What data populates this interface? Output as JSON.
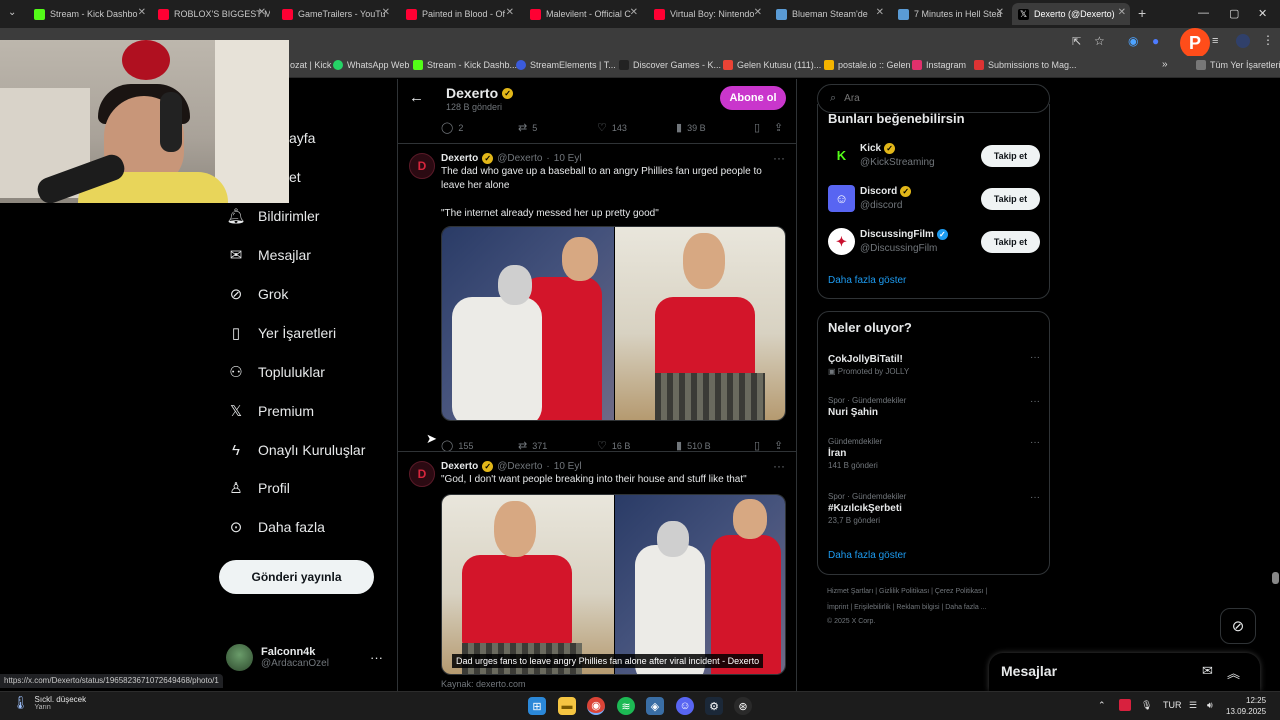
{
  "browser": {
    "tabs": [
      {
        "label": "Stream - Kick Dashbo",
        "color": "#53fc18"
      },
      {
        "label": "ROBLOX'S BIGGEST M",
        "color": "#ff0033"
      },
      {
        "label": "GameTrailers - YouTu",
        "color": "#ff0033"
      },
      {
        "label": "Painted in Blood - Of",
        "color": "#ff0033"
      },
      {
        "label": "Malevilent - Official C",
        "color": "#ff0033"
      },
      {
        "label": "Virtual Boy: Nintendo",
        "color": "#ff0033"
      },
      {
        "label": "Blueman Steam'de",
        "color": "#5a9bd5"
      },
      {
        "label": "7 Minutes in Hell Stea",
        "color": "#5a9bd5"
      },
      {
        "label": "Dexerto (@Dexerto)",
        "color": "#ffffff",
        "active": true
      }
    ],
    "new_tab": "+",
    "window_controls": [
      "—",
      "▢",
      "✕"
    ],
    "bookmarks": [
      {
        "label": "ozat | Kick",
        "color": "#53fc18"
      },
      {
        "label": "WhatsApp Web",
        "color": "#25d366"
      },
      {
        "label": "Stream - Kick Dashb...",
        "color": "#53fc18"
      },
      {
        "label": "StreamElements | T...",
        "color": "#3b5bdb"
      },
      {
        "label": "Discover Games - K...",
        "color": "#222222"
      },
      {
        "label": "Gelen Kutusu (111)...",
        "color": "#ea4335"
      },
      {
        "label": "postale.io :: Gelen",
        "color": "#f4b400"
      },
      {
        "label": "Instagram",
        "color": "#e1306c"
      },
      {
        "label": "Submissions to Mag...",
        "color": "#d33"
      }
    ],
    "all_bookmarks": "Tüm Yer İşaretleri",
    "status_url": "https://x.com/Dexerto/status/1965823671072649468/photo/1"
  },
  "nav": {
    "items": [
      {
        "label": "ayfa",
        "icon": "home-icon"
      },
      {
        "label": "et",
        "icon": "explore-icon"
      },
      {
        "label": "Bildirimler",
        "icon": "bell-icon"
      },
      {
        "label": "Mesajlar",
        "icon": "envelope-icon"
      },
      {
        "label": "Grok",
        "icon": "grok-icon"
      },
      {
        "label": "Yer İşaretleri",
        "icon": "bookmark-icon"
      },
      {
        "label": "Topluluklar",
        "icon": "communities-icon"
      },
      {
        "label": "Premium",
        "icon": "x-logo-icon"
      },
      {
        "label": "Onaylı Kuruluşlar",
        "icon": "lightning-icon"
      },
      {
        "label": "Profil",
        "icon": "person-icon"
      },
      {
        "label": "Daha fazla",
        "icon": "more-circle-icon"
      }
    ],
    "post_button": "Gönderi yayınla",
    "account": {
      "name": "Falconn4k",
      "handle": "@ArdacanOzel"
    }
  },
  "profile_header": {
    "name": "Dexerto",
    "post_count": "128 B gönderi",
    "subscribe": "Abone ol"
  },
  "top_actions": {
    "replies": "2",
    "reposts": "5",
    "likes": "143",
    "views": "39 B"
  },
  "tweets": [
    {
      "name": "Dexerto",
      "handle": "@Dexerto",
      "date": "10 Eyl",
      "text": "The dad who gave up a baseball to an angry Phillies fan urged people to leave her alone\n\n\"The internet already messed her up pretty good\"",
      "actions": {
        "replies": "155",
        "reposts": "371",
        "likes": "16 B",
        "views": "510 B"
      }
    },
    {
      "name": "Dexerto",
      "handle": "@Dexerto",
      "date": "10 Eyl",
      "text": "\"God, I don't want people breaking into their house and stuff like that\"",
      "caption": "Dad urges fans to leave angry Phillies fan alone after viral incident - Dexerto",
      "source": "Kaynak: dexerto.com"
    }
  ],
  "search": {
    "placeholder": "Ara"
  },
  "who_to_follow": {
    "title": "Bunları beğenebilirsin",
    "items": [
      {
        "name": "Kick",
        "handle": "@KickStreaming",
        "button": "Takip et",
        "badge": "gold"
      },
      {
        "name": "Discord",
        "handle": "@discord",
        "button": "Takip et",
        "badge": "gold"
      },
      {
        "name": "DiscussingFilm",
        "handle": "@DiscussingFilm",
        "button": "Takip et",
        "badge": "blue"
      }
    ],
    "show_more": "Daha fazla göster"
  },
  "trends": {
    "title": "Neler oluyor?",
    "items": [
      {
        "category": "",
        "name": "ÇokJollyBiTatil!",
        "sub": "Promoted by JOLLY"
      },
      {
        "category": "Spor · Gündemdekiler",
        "name": "Nuri Şahin",
        "sub": ""
      },
      {
        "category": "Gündemdekiler",
        "name": "İran",
        "sub": "141 B gönderi"
      },
      {
        "category": "Spor · Gündemdekiler",
        "name": "#KızılcıkŞerbeti",
        "sub": "23,7 B gönderi"
      }
    ],
    "show_more": "Daha fazla göster"
  },
  "footer": {
    "line1": "Hizmet Şartları  |  Gizlilik Politikası  |  Çerez Politikası  |",
    "line2": "İmprint  |  Erişilebilirlik  |  Reklam bilgisi  |  Daha fazla ...",
    "line3": "© 2025 X Corp."
  },
  "messages_drawer": {
    "title": "Mesajlar"
  },
  "taskbar": {
    "weather_title": "Sıckl. düşecek",
    "weather_sub": "Yarın",
    "lang": "TUR",
    "time": "12:25",
    "date": "13.09.2025"
  },
  "colors": {
    "accent": "#1d9bf0",
    "subscribe": "#c936cc",
    "verified_gold": "#e2b719"
  }
}
